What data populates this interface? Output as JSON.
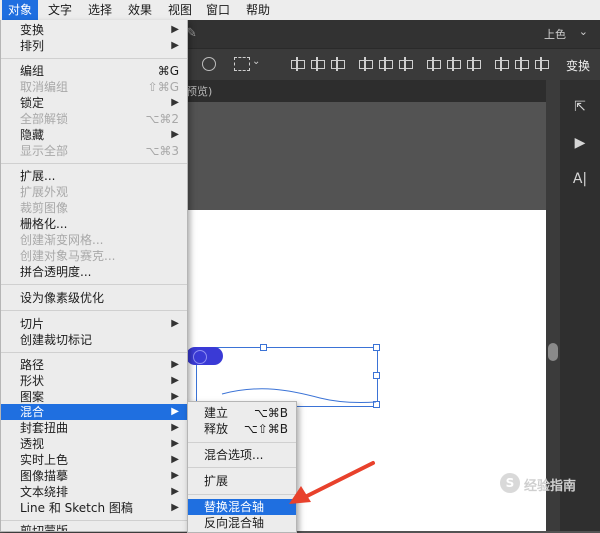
{
  "menubar": {
    "items": [
      "对象",
      "文字",
      "选择",
      "效果",
      "视图",
      "窗口",
      "帮助"
    ]
  },
  "app": {
    "top_right_label": "上色",
    "tab_fragment": "预览)",
    "ctrl_transform": "变换"
  },
  "object_menu": {
    "items": [
      {
        "label": "变换",
        "submenu": true
      },
      {
        "label": "排列",
        "submenu": true
      },
      {
        "label": "编组",
        "shortcut": "⌘G"
      },
      {
        "label": "取消编组",
        "shortcut": "⇧⌘G",
        "disabled": true
      },
      {
        "label": "锁定",
        "submenu": true
      },
      {
        "label": "全部解锁",
        "shortcut": "⌥⌘2",
        "disabled": true
      },
      {
        "label": "隐藏",
        "submenu": true
      },
      {
        "label": "显示全部",
        "shortcut": "⌥⌘3",
        "disabled": true
      },
      {
        "label": "扩展..."
      },
      {
        "label": "扩展外观",
        "disabled": true
      },
      {
        "label": "裁剪图像",
        "disabled": true
      },
      {
        "label": "栅格化..."
      },
      {
        "label": "创建渐变网格...",
        "disabled": true
      },
      {
        "label": "创建对象马赛克...",
        "disabled": true
      },
      {
        "label": "拼合透明度..."
      },
      {
        "label": "设为像素级优化"
      },
      {
        "label": "切片",
        "submenu": true
      },
      {
        "label": "创建裁切标记"
      },
      {
        "label": "路径",
        "submenu": true
      },
      {
        "label": "形状",
        "submenu": true
      },
      {
        "label": "图案",
        "submenu": true
      },
      {
        "label": "混合",
        "submenu": true,
        "highlighted": true
      },
      {
        "label": "封套扭曲",
        "submenu": true
      },
      {
        "label": "透视",
        "submenu": true
      },
      {
        "label": "实时上色",
        "submenu": true
      },
      {
        "label": "图像描摹",
        "submenu": true
      },
      {
        "label": "文本绕排",
        "submenu": true
      },
      {
        "label": "Line 和 Sketch 图稿",
        "submenu": true
      },
      {
        "label": "剪切蒙版",
        "submenu": true
      }
    ]
  },
  "blend_submenu": {
    "items": [
      {
        "label": "建立",
        "shortcut": "⌥⌘B"
      },
      {
        "label": "释放",
        "shortcut": "⌥⇧⌘B"
      },
      {
        "label": "混合选项..."
      },
      {
        "label": "扩展"
      },
      {
        "label": "替换混合轴",
        "highlighted": true
      },
      {
        "label": "反向混合轴"
      }
    ]
  },
  "watermark": {
    "text": "经验指南"
  },
  "colors": {
    "highlight": "#1f6fe0",
    "arrow": "#e8412c",
    "blend_fill": "#3a3ad6"
  }
}
